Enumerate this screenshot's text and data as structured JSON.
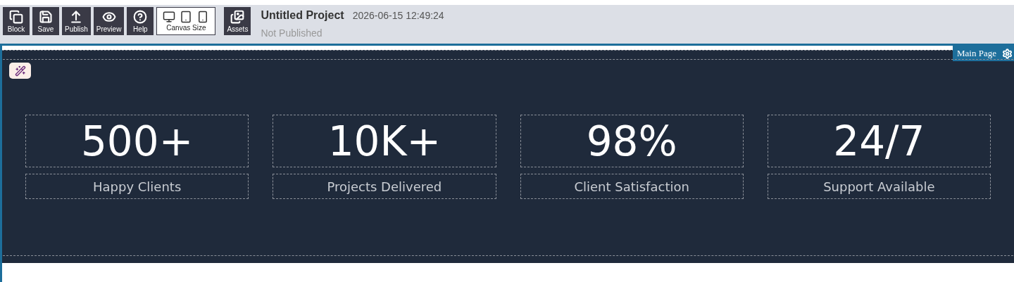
{
  "toolbar": {
    "buttons": [
      {
        "kind": "block",
        "label": "Block"
      },
      {
        "kind": "save",
        "label": "Save"
      },
      {
        "kind": "publish",
        "label": "Publish"
      },
      {
        "kind": "preview",
        "label": "Preview"
      },
      {
        "kind": "help",
        "label": "Help"
      }
    ],
    "canvas_size": {
      "label": "Canvas Size",
      "devices": [
        {
          "kind": "desktop"
        },
        {
          "kind": "tablet"
        },
        {
          "kind": "phone"
        }
      ]
    },
    "assets": {
      "kind": "assets",
      "label": "Assets"
    }
  },
  "project": {
    "title": "Untitled Project",
    "timestamp": "2026-06-15 12:49:24",
    "status": "Not Published"
  },
  "page_tab": {
    "label": "Main Page"
  },
  "stats": [
    {
      "value": "500+",
      "label": "Happy Clients"
    },
    {
      "value": "10K+",
      "label": "Projects Delivered"
    },
    {
      "value": "98%",
      "label": "Client Satisfaction"
    },
    {
      "value": "24/7",
      "label": "Support Available"
    }
  ]
}
